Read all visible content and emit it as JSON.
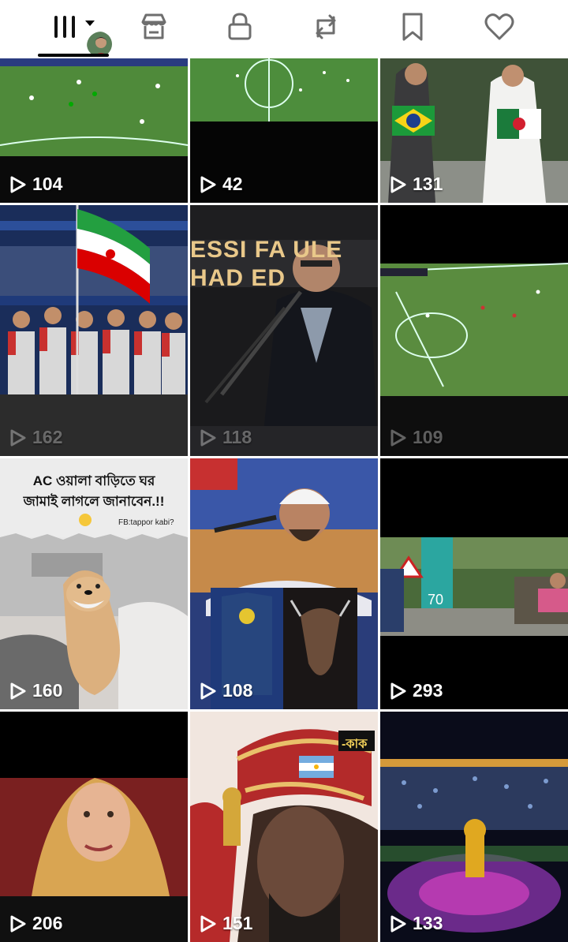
{
  "tabs": [
    {
      "name": "tab-videos",
      "icon": "grid-bars-icon"
    },
    {
      "name": "tab-shop",
      "icon": "shop-icon"
    },
    {
      "name": "tab-private",
      "icon": "lock-icon"
    },
    {
      "name": "tab-reposts",
      "icon": "repost-icon"
    },
    {
      "name": "tab-favorites",
      "icon": "bookmark-icon"
    },
    {
      "name": "tab-liked",
      "icon": "heart-icon"
    }
  ],
  "videos": [
    {
      "views": "104"
    },
    {
      "views": "42"
    },
    {
      "views": "131"
    },
    {
      "views": "162"
    },
    {
      "views": "118"
    },
    {
      "views": "109"
    },
    {
      "views": "160",
      "caption_line1": "AC ওয়ালা বাড়িতে ঘর",
      "caption_line2": "জামাই লাগলে জানাবেন.!!",
      "caption_tag": "FB:tappor kabi?"
    },
    {
      "views": "108"
    },
    {
      "views": "293"
    },
    {
      "views": "206"
    },
    {
      "views": "151",
      "sticker": "-কাক"
    },
    {
      "views": "133"
    }
  ],
  "overlays": {
    "banner_line1": "ESSI FA  ULE",
    "banner_line2": "HAD ED"
  }
}
